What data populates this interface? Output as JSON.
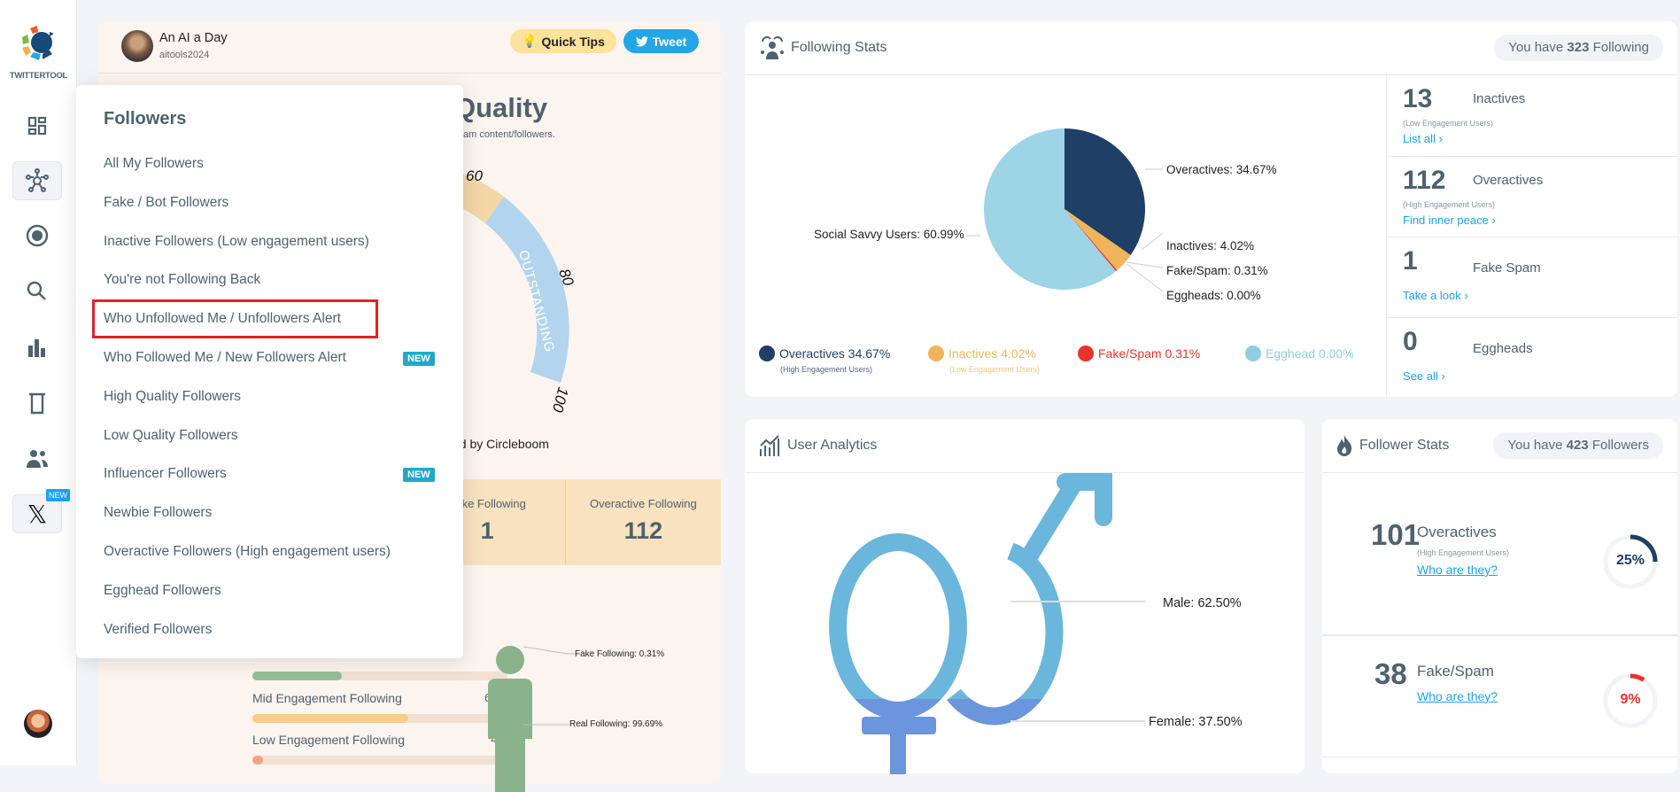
{
  "sidebar": {
    "logo_text": "TWITTERTOOL",
    "icons": [
      "dashboard-icon",
      "network-icon",
      "target-icon",
      "search-icon",
      "bar-chart-icon",
      "trash-icon",
      "users-icon",
      "x-logo-icon"
    ],
    "x_badge": "NEW"
  },
  "profile": {
    "name": "An AI a Day",
    "handle": "aitools2024"
  },
  "header_buttons": {
    "quick_tips": "Quick Tips",
    "tweet": "Tweet"
  },
  "quality": {
    "title_fragment": "Quality",
    "subtitle_fragment": "am content/followers.",
    "powered_fragment": "ed by Circleboom",
    "gauge_ticks": [
      "60",
      "80",
      "100"
    ],
    "gauge_band": "OUTSTANDING"
  },
  "following_boxes": [
    {
      "label": "Fake Following",
      "value": "1"
    },
    {
      "label": "Overactive Following",
      "value": "112"
    }
  ],
  "engagement": [
    {
      "label": "",
      "pct": "",
      "fill": 35,
      "color": "#97bd98"
    },
    {
      "label": "Mid Engagement Following",
      "pct": "61%",
      "fill": 61,
      "color": "#f7cd88"
    },
    {
      "label": "Low Engagement Following",
      "pct": "4%",
      "fill": 4,
      "color": "#f2a488"
    }
  ],
  "person": {
    "fake": "Fake Following: 0.31%",
    "real": "Real Following: 99.69%"
  },
  "menu": {
    "title": "Followers",
    "items": [
      {
        "label": "All My Followers",
        "badge": ""
      },
      {
        "label": "Fake / Bot Followers",
        "badge": ""
      },
      {
        "label": "Inactive Followers (Low engagement users)",
        "badge": ""
      },
      {
        "label": "You're not Following Back",
        "badge": ""
      },
      {
        "label": "Who Unfollowed Me / Unfollowers Alert",
        "badge": "",
        "highlighted": true
      },
      {
        "label": "Who Followed Me / New Followers Alert",
        "badge": "NEW"
      },
      {
        "label": "High Quality Followers",
        "badge": ""
      },
      {
        "label": "Low Quality Followers",
        "badge": ""
      },
      {
        "label": "Influencer Followers",
        "badge": "NEW"
      },
      {
        "label": "Newbie Followers",
        "badge": ""
      },
      {
        "label": "Overactive Followers (High engagement users)",
        "badge": ""
      },
      {
        "label": "Egghead Followers",
        "badge": ""
      },
      {
        "label": "Verified Followers",
        "badge": ""
      }
    ]
  },
  "following_stats": {
    "title": "Following Stats",
    "pill_pre": "You have",
    "pill_num": "323",
    "pill_post": "Following",
    "pie": [
      {
        "label": "Overactives: 34.67%",
        "value": 34.67,
        "color": "#1f3f66"
      },
      {
        "label": "Inactives: 4.02%",
        "value": 4.02,
        "color": "#f0b55a"
      },
      {
        "label": "Fake/Spam: 0.31%",
        "value": 0.31,
        "color": "#e8322a"
      },
      {
        "label": "Eggheads: 0.00%",
        "value": 0,
        "color": "#8fcfe0"
      },
      {
        "label": "Social Savvy Users: 60.99%",
        "value": 60.99,
        "color": "#9dd4e6"
      }
    ],
    "legend": [
      {
        "label": "Overactives 34.67%",
        "sub": "(High Engagement Users)",
        "color": "#1f3f66",
        "icon": "brain-icon"
      },
      {
        "label": "Inactives 4.02%",
        "sub": "(Low Engagement Users)",
        "color": "#f0b55a",
        "icon": "sad-face-icon"
      },
      {
        "label": "Fake/Spam 0.31%",
        "sub": "",
        "color": "#e8322a",
        "icon": "angry-face-icon"
      },
      {
        "label": "Egghead 0.00%",
        "sub": "",
        "color": "#8fcfe0",
        "icon": "drop-icon"
      }
    ],
    "side": [
      {
        "num": "13",
        "label": "Inactives",
        "sub": "(Low Engagement Users)",
        "link": "List all ›"
      },
      {
        "num": "112",
        "label": "Overactives",
        "sub": "(High Engagement Users)",
        "link": "Find inner peace ›"
      },
      {
        "num": "1",
        "label": "Fake Spam",
        "sub": "",
        "link": "Take a look ›"
      },
      {
        "num": "0",
        "label": "Eggheads",
        "sub": "",
        "link": "See all ›"
      }
    ]
  },
  "user_analytics": {
    "title": "User Analytics",
    "male": "Male: 62.50%",
    "female": "Female: 37.50%",
    "male_color": "#6ab6dc",
    "female_color": "#6b95dc"
  },
  "follower_stats": {
    "title": "Follower Stats",
    "pill_pre": "You have",
    "pill_num": "423",
    "pill_post": "Followers",
    "rows": [
      {
        "num": "101",
        "label": "Overactives",
        "sub": "(High Engagement Users)",
        "link": "Who are they?",
        "pct": "25%",
        "fill": 25,
        "color": "#1f3f66"
      },
      {
        "num": "38",
        "label": "Fake/Spam",
        "sub": "",
        "link": "Who are they?",
        "pct": "9%",
        "fill": 9,
        "color": "#e8322a"
      }
    ]
  }
}
